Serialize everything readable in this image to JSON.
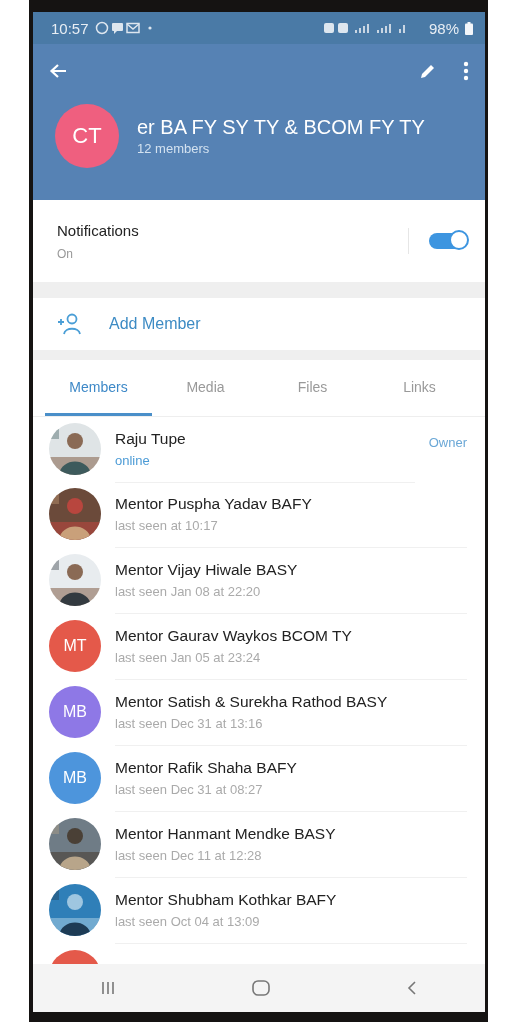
{
  "status_bar": {
    "time": "10:57",
    "battery": "98%"
  },
  "group": {
    "initials": "CT",
    "color": "#ef5f7f",
    "title": "er BA FY SY TY & BCOM FY TY",
    "subtitle": "12 members"
  },
  "notifications": {
    "label": "Notifications",
    "value": "On",
    "on": true
  },
  "add_member": {
    "label": "Add Member"
  },
  "tabs": [
    {
      "label": "Members",
      "selected": true
    },
    {
      "label": "Media",
      "selected": false
    },
    {
      "label": "Files",
      "selected": false
    },
    {
      "label": "Links",
      "selected": false
    }
  ],
  "members": [
    {
      "kind": "picture",
      "name": "Raju Tupe",
      "status": "online",
      "online": true,
      "badge": "Owner"
    },
    {
      "kind": "picture",
      "name": "Mentor Puspha Yadav BAFY",
      "status": "last seen at 10:17",
      "online": false
    },
    {
      "kind": "picture",
      "name": "Mentor Vijay Hiwale BASY",
      "status": "last seen Jan 08 at 22:20",
      "online": false
    },
    {
      "kind": "initials",
      "initials": "MT",
      "color": "#e4594a",
      "name": "Mentor Gaurav Waykos BCOM TY",
      "status": "last seen Jan 05 at 23:24",
      "online": false
    },
    {
      "kind": "initials",
      "initials": "MB",
      "color": "#8e78e6",
      "name": "Mentor Satish & Surekha Rathod BASY",
      "status": "last seen Dec 31 at 13:16",
      "online": false
    },
    {
      "kind": "initials",
      "initials": "MB",
      "color": "#4d95dc",
      "name": "Mentor Rafik Shaha BAFY",
      "status": "last seen Dec 31 at 08:27",
      "online": false
    },
    {
      "kind": "picture",
      "name": "Mentor Hanmant Mendke BASY",
      "status": "last seen Dec 11 at 12:28",
      "online": false
    },
    {
      "kind": "picture",
      "name": "Mentor Shubham Kothkar BAFY",
      "status": "last seen Oct 04 at 13:09",
      "online": false
    },
    {
      "kind": "cut",
      "color": "#e4594a"
    }
  ]
}
